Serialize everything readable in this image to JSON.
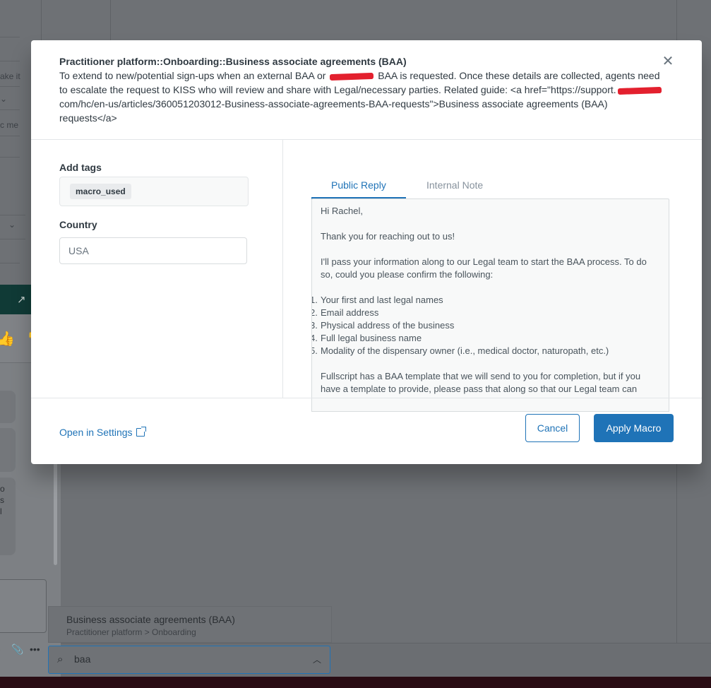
{
  "background": {
    "snippets": [
      "ake it",
      "c me"
    ]
  },
  "modal": {
    "title": "Practitioner platform::Onboarding::Business associate agreements (BAA)",
    "desc_part1": "To extend to new/potential sign-ups when an external BAA or",
    "desc_part2": "BAA is requested. Once these details are collected, agents need to escalate the request to KISS who will review and share with Legal/necessary parties. Related guide: <a href=\"https://support.",
    "desc_part3": "com/hc/en-us/articles/360051203012-Business-associate-agreements-BAA-requests\">Business associate agreements (BAA) requests</a>",
    "close_icon": "close-icon",
    "add_tags_label": "Add tags",
    "tag": "macro_used",
    "country_label": "Country",
    "country_value": "USA",
    "tabs": [
      {
        "label": "Public Reply",
        "active": true
      },
      {
        "label": "Internal Note",
        "active": false
      }
    ],
    "reply": {
      "greeting": "Hi Rachel,",
      "thanks": "Thank you for reaching out to us!",
      "intro": "I'll pass your information along to our Legal team to start the BAA process. To do so, could you please confirm the following:",
      "items": [
        {
          "num": "1.",
          "text": "Your first and last legal names"
        },
        {
          "num": "2.",
          "text": "Email address"
        },
        {
          "num": "3.",
          "text": "Physical address of the business"
        },
        {
          "num": "4.",
          "text": "Full legal business name"
        },
        {
          "num": "5.",
          "text": "Modality of the dispensary owner (i.e., medical doctor, naturopath, etc.)"
        }
      ],
      "closing": "Fullscript has a BAA template that we will send to you for completion, but if you have a template to provide, please pass that along so that our Legal team can"
    },
    "open_settings": "Open in Settings",
    "cancel": "Cancel",
    "apply": "Apply Macro"
  },
  "chat": {
    "partial_text": [
      "o",
      "s",
      "l"
    ]
  },
  "macro_suggestion": {
    "title": "Business associate agreements (BAA)",
    "path": "Practitioner platform > Onboarding"
  },
  "macro_search": {
    "value": "baa"
  },
  "colors": {
    "accent": "#1f73b7",
    "overlay": "#6e7175",
    "chat_header": "#103a36",
    "redaction": "#e3202e"
  }
}
